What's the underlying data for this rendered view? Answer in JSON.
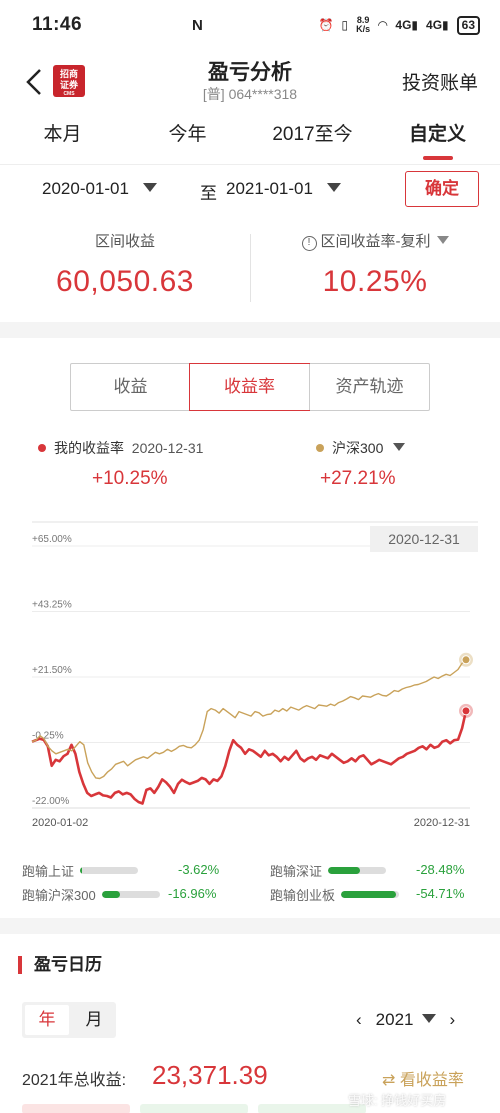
{
  "status": {
    "time": "11:46",
    "nfc": "N",
    "speed_top": "8.9",
    "speed_bottom": "K/s",
    "net1": "4G",
    "net2": "4G",
    "battery": "63"
  },
  "header": {
    "logo_line1": "招商",
    "logo_line2": "证券",
    "logo_small": "CMS",
    "title": "盈亏分析",
    "account": "[普] 064****318",
    "right_link": "投资账单"
  },
  "tabs": [
    {
      "label": "本月"
    },
    {
      "label": "今年"
    },
    {
      "label": "2017至今"
    },
    {
      "label": "自定义"
    }
  ],
  "date_filter": {
    "start": "2020-01-01",
    "to": "至",
    "end": "2021-01-01",
    "confirm": "确定"
  },
  "summary": {
    "left_label": "区间收益",
    "left_value": "60,050.63",
    "right_label": "区间收益率-复利",
    "right_value": "10.25%"
  },
  "segments": [
    {
      "label": "收益"
    },
    {
      "label": "收益率"
    },
    {
      "label": "资产轨迹"
    }
  ],
  "legend": {
    "mine_label": "我的收益率",
    "mine_date": "2020-12-31",
    "mine_value": "+10.25%",
    "index_label": "沪深300",
    "index_value": "+27.21%",
    "mine_color": "#d8363a",
    "index_color": "#c9a25a"
  },
  "chart_data": {
    "type": "line",
    "date_tag": "2020-12-31",
    "x_start": "2020-01-02",
    "x_end": "2020-12-31",
    "yticks": [
      "+65.00%",
      "+43.25%",
      "+21.50%",
      "-0.25%",
      "-22.00%"
    ],
    "ylim": [
      -22.0,
      65.0
    ],
    "series": [
      {
        "name": "我的收益率",
        "color": "#d8363a",
        "values": [
          0,
          0.5,
          1,
          0.6,
          -1.5,
          -8,
          -6,
          -6.5,
          -4.8,
          -4,
          -1,
          -4,
          -10,
          -14,
          -17,
          -18,
          -17.5,
          -17,
          -17.8,
          -18,
          -18.5,
          -17,
          -16.5,
          -17.5,
          -17,
          -17.5,
          -19,
          -20,
          -20.5,
          -16,
          -15.5,
          -17,
          -15,
          -12.5,
          -13.5,
          -15,
          -17,
          -14,
          -12.6,
          -13.4,
          -14,
          -13.5,
          -13,
          -12,
          -12.5,
          -14,
          -12.5,
          -13,
          -11.5,
          -8,
          -3,
          0.5,
          -1,
          -2,
          -4,
          -2.5,
          -3,
          -4,
          -5,
          -3,
          -4.5,
          -4,
          -5,
          -6.5,
          -5,
          -6,
          -4.5,
          -3,
          -5.5,
          -6.5,
          -5.5,
          -5,
          -6,
          -4.5,
          -5,
          -5.5,
          -4,
          -5,
          -6,
          -7,
          -6.5,
          -5.5,
          -6.5,
          -5,
          -4.5,
          -6,
          -7.5,
          -6.8,
          -6,
          -6.5,
          -7,
          -7.5,
          -6.5,
          -5.5,
          -5,
          -4,
          -3.5,
          -3,
          -2,
          -1.5,
          -2.5,
          -1,
          -2,
          -1.5,
          0,
          0.5,
          -0.5,
          0.5,
          0.7,
          4.5,
          10.25
        ]
      },
      {
        "name": "沪深300",
        "color": "#c9a25a",
        "values": [
          0,
          0.5,
          2,
          1,
          -1.5,
          -3,
          -4,
          -3.5,
          -3,
          -2.5,
          -3,
          -1.5,
          0,
          -1,
          -7,
          -10,
          -12,
          -12.2,
          -11.5,
          -10,
          -9,
          -7.5,
          -7,
          -6.5,
          -8,
          -7,
          -6,
          -5.5,
          -5,
          -5.5,
          -4.5,
          -3.5,
          -4,
          -3.5,
          -2.5,
          -3.2,
          -2.5,
          -1.5,
          -1.2,
          -1.8,
          -2,
          -1,
          0.5,
          4,
          10,
          11,
          10.5,
          9.5,
          11,
          10,
          9,
          8,
          10,
          9.5,
          9,
          8.5,
          10,
          9.6,
          8.5,
          9,
          9.2,
          10.5,
          10,
          11,
          10.2,
          11.5,
          11,
          10.5,
          11.4,
          12,
          11.5,
          11,
          12.2,
          12,
          11.8,
          12.5,
          12,
          13,
          13.5,
          14.2,
          15,
          14.6,
          14,
          15.2,
          15,
          14.8,
          15.5,
          16,
          15.4,
          15.2,
          16,
          17,
          16.7,
          17.5,
          18,
          18.3,
          18.8,
          19,
          19.5,
          20,
          20.8,
          21.5,
          21,
          21.8,
          22.4,
          22,
          23,
          24,
          26,
          27.21
        ]
      }
    ]
  },
  "beats": {
    "sz_label": "跑输上证",
    "sz_value": "-3.62%",
    "sz_fill": 0.04,
    "sr_label": "跑输深证",
    "sr_value": "-28.48%",
    "sr_fill": 0.55,
    "hs_label": "跑输沪深300",
    "hs_value": "-16.96%",
    "hs_fill": 0.32,
    "cy_label": "跑输创业板",
    "cy_value": "-54.71%",
    "cy_fill": 0.95
  },
  "calendar": {
    "title": "盈亏日历",
    "year_tab": "年",
    "month_tab": "月",
    "year": "2021",
    "total_label": "2021年总收益:",
    "total_value": "23,371.39",
    "toggle": "看收益率",
    "watermark": "雪球: 挣钱好买房"
  }
}
